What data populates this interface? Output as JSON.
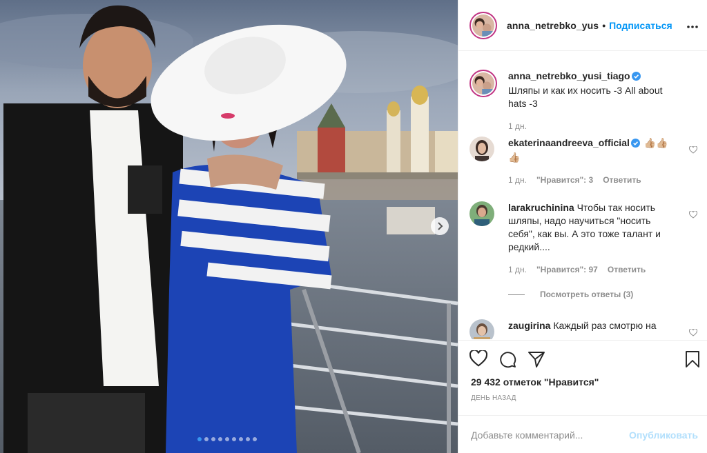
{
  "post": {
    "author": "anna_netrebko_yus",
    "follow_label": "Подписаться",
    "separator": "•",
    "media": {
      "slide_count": 9,
      "active_slide": 1
    }
  },
  "caption": {
    "username": "anna_netrebko_yusi_tiago",
    "text": " Шляпы и как их носить -3 All about hats -3",
    "time": "1 дн."
  },
  "comments": [
    {
      "username": "ekaterinaandreeva_official",
      "text": " 👍🏼👍🏼👍🏼",
      "time": "1 дн.",
      "likes": "\"Нравится\": 3",
      "reply": "Ответить",
      "verified": true
    },
    {
      "username": "larakruchinina",
      "text": " Чтобы так носить шляпы, надо научиться \"носить себя\", как вы. А это тоже талант и редкий....",
      "time": "1 дн.",
      "likes": "\"Нравится\": 97",
      "reply": "Ответить",
      "verified": false
    },
    {
      "username": "zaugirina",
      "text": " Каждый раз смотрю на",
      "verified": false
    }
  ],
  "view_replies": "Посмотреть ответы (3)",
  "stats": {
    "likes": "29 432 отметок \"Нравится\"",
    "timestamp": "ДЕНЬ НАЗАД"
  },
  "comment_form": {
    "placeholder": "Добавьте комментарий...",
    "publish": "Опубликовать"
  },
  "colors": {
    "link": "#0095f6",
    "publish_disabled": "#b2dffc",
    "verified": "#3897f0",
    "muted": "#8e8e8e"
  },
  "icons": [
    "chevron-right-icon",
    "more-icon",
    "verified-icon",
    "heart-icon",
    "comment-icon",
    "share-icon",
    "bookmark-icon"
  ]
}
